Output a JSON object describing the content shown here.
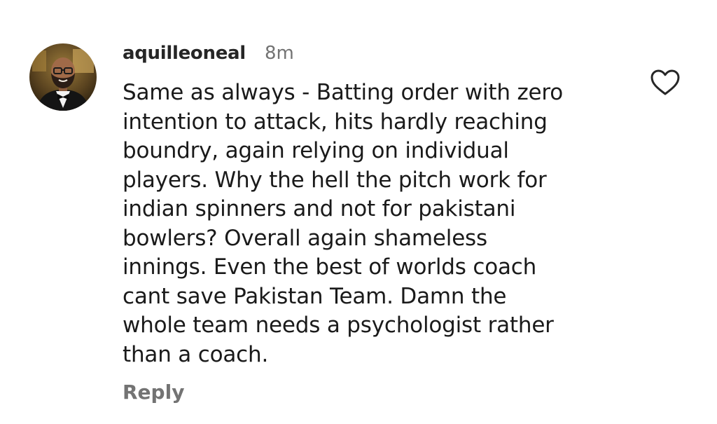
{
  "comment": {
    "username": "aquilleoneal",
    "time": "8m",
    "text_lines": [
      "Same as always - Batting order with zero",
      "intention to attack, hits hardly reaching",
      "boundry, again relying on individual",
      "players. Why the hell the pitch work for",
      "indian spinners and not for pakistani",
      "bowlers? Overall again shameless",
      "innings. Even the best of worlds coach",
      "cant save Pakistan Team. Damn the",
      "whole team needs a psychologist rather",
      "than a coach."
    ],
    "reply_label": "Reply",
    "like_icon": "heart-outline-icon",
    "avatar_icon": "user-avatar"
  },
  "colors": {
    "text": "#1a1a1a",
    "username": "#262626",
    "muted": "#737373",
    "icon": "#262626"
  }
}
